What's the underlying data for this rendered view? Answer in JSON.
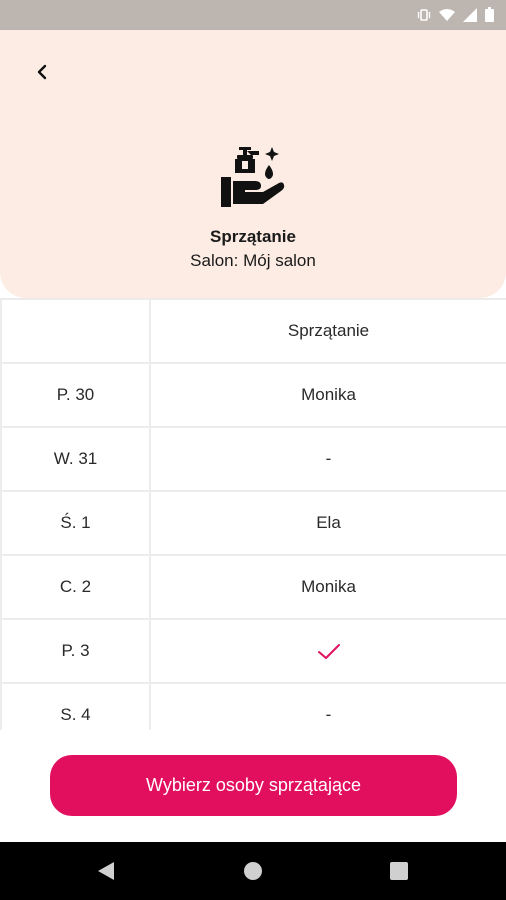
{
  "header": {
    "title": "Sprzątanie",
    "subtitle": "Salon: Mój salon"
  },
  "table": {
    "column_header": "Sprzątanie",
    "rows": [
      {
        "day": "P. 30",
        "value": "Monika"
      },
      {
        "day": "W. 31",
        "value": "-"
      },
      {
        "day": "Ś. 1",
        "value": "Ela"
      },
      {
        "day": "C. 2",
        "value": "Monika"
      },
      {
        "day": "P. 3",
        "value": "",
        "icon": "checkmark-icon"
      },
      {
        "day": "S. 4",
        "value": "-"
      }
    ]
  },
  "action": {
    "button_label": "Wybierz osoby sprzątające"
  },
  "icons": {
    "back": "chevron-left-icon",
    "service": "hand-wash-icon",
    "status": [
      "vibrate-icon",
      "wifi-icon",
      "signal-icon",
      "battery-icon"
    ],
    "nav": [
      "nav-back-icon",
      "nav-home-icon",
      "nav-recent-icon"
    ]
  },
  "colors": {
    "accent": "#e20f5f",
    "header_bg": "#fcece3",
    "status_bar": "#bdb6b0"
  }
}
